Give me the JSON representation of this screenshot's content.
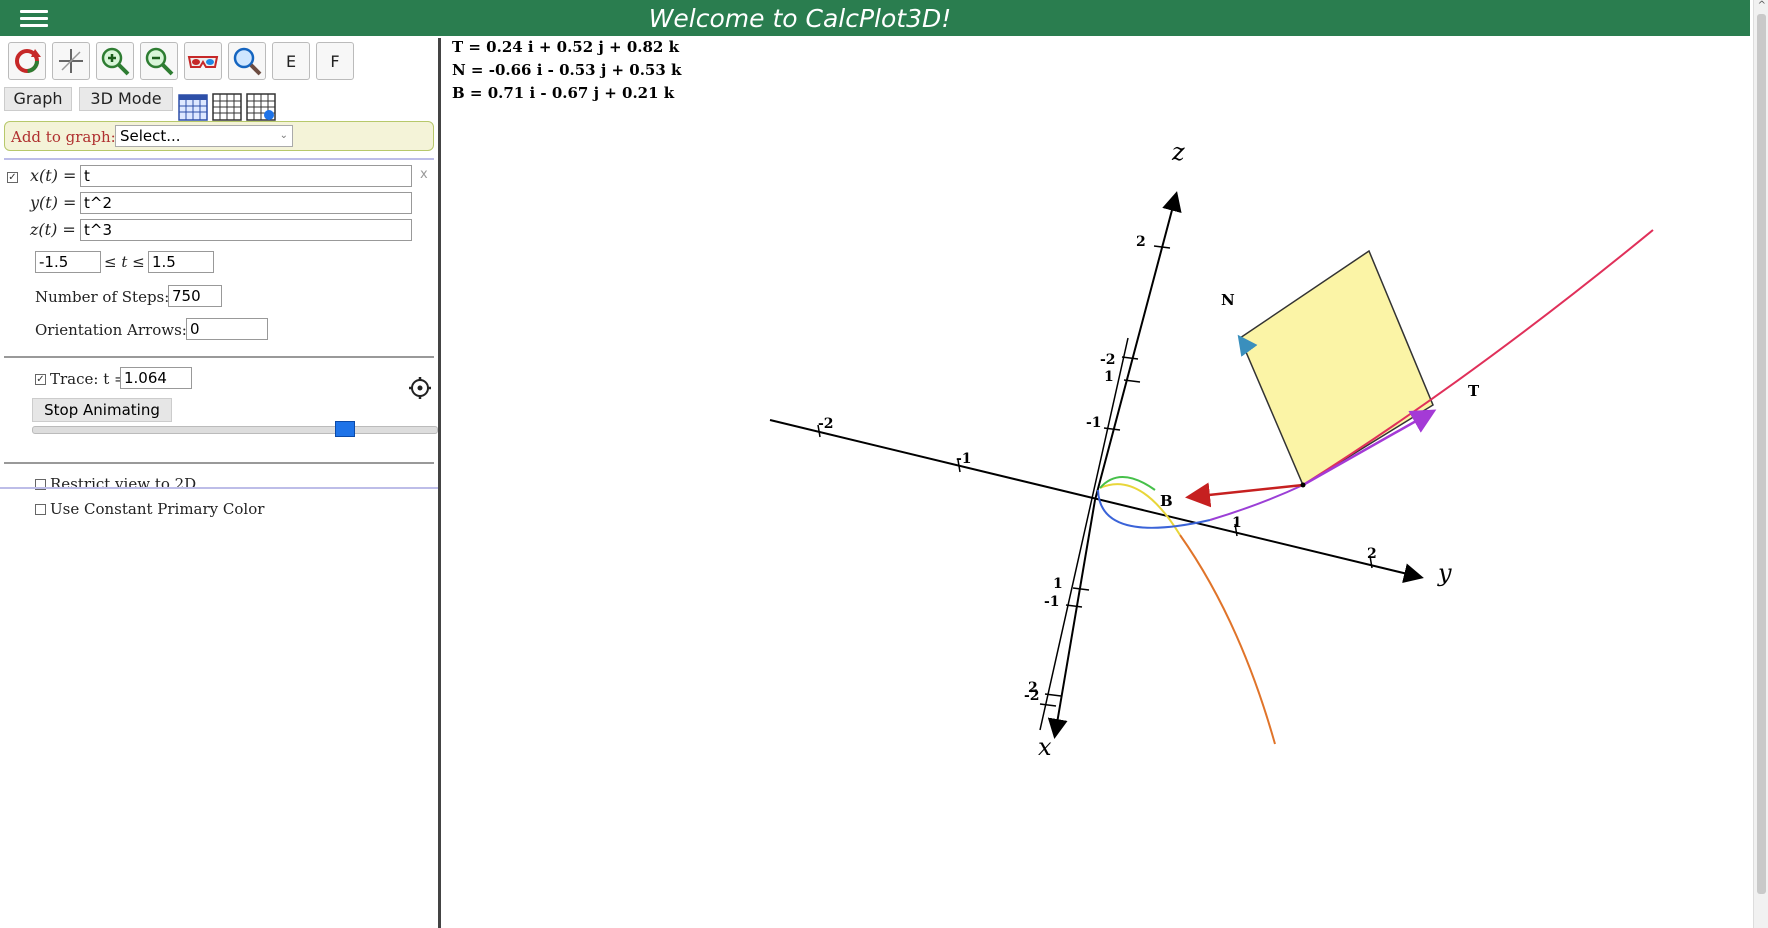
{
  "header": {
    "title": "Welcome to CalcPlot3D!"
  },
  "toolbar": {
    "buttons": [
      {
        "name": "rotate-icon"
      },
      {
        "name": "axes-center-icon"
      },
      {
        "name": "zoom-in-icon"
      },
      {
        "name": "zoom-out-icon"
      },
      {
        "name": "3d-glasses-icon"
      },
      {
        "name": "magnifier-icon"
      },
      {
        "label": "E"
      },
      {
        "label": "F"
      }
    ]
  },
  "tabs": {
    "graph": "Graph",
    "mode": "3D Mode"
  },
  "add_to_graph": {
    "label": "Add to graph:",
    "selected": "Select..."
  },
  "curve": {
    "checked": true,
    "x_label": "x(t) =",
    "x_value": "t",
    "y_label": "y(t) =",
    "y_value": "t^2",
    "z_label": "z(t) =",
    "z_value": "t^3",
    "remove": "x",
    "t_min": "-1.5",
    "t_range_label": "≤ t ≤",
    "t_max": "1.5",
    "steps_label": "Number of Steps:",
    "steps_value": "750",
    "arrows_label": "Orientation Arrows:",
    "arrows_value": "0",
    "trace_label": "Trace: t =",
    "trace_value": "1.064",
    "trace_checked": true,
    "stop_button": "Stop Animating",
    "slider_fraction": 0.79,
    "restrict_label": "Restrict view to 2D",
    "restrict_checked": false,
    "constant_color_label": "Use Constant Primary Color",
    "constant_color_checked": false
  },
  "vectors": {
    "T": "T = 0.24 i + 0.52 j + 0.82 k",
    "N": "N = -0.66 i - 0.53 j + 0.53 k",
    "B": "B = 0.71 i - 0.67 j + 0.21 k"
  },
  "plot": {
    "axis_x": "x",
    "axis_y": "y",
    "axis_z": "z",
    "vector_labels": {
      "T": "T",
      "N": "N",
      "B": "B"
    },
    "ticks": {
      "y_neg2": "-2",
      "y_neg1": "-1",
      "y_1": "1",
      "y_2": "2",
      "z_2": "2",
      "z_neg1": "-1",
      "z_neg2": "-2",
      "z_1": "1",
      "x_1": "1",
      "x_neg1": "-1",
      "x_neg2": "-2",
      "x_2": "2"
    },
    "colors": {
      "tangent": "#a43ad6",
      "binormal": "#c62020",
      "plane": "#fbf4a6",
      "curve_end": "#e0305a"
    }
  }
}
